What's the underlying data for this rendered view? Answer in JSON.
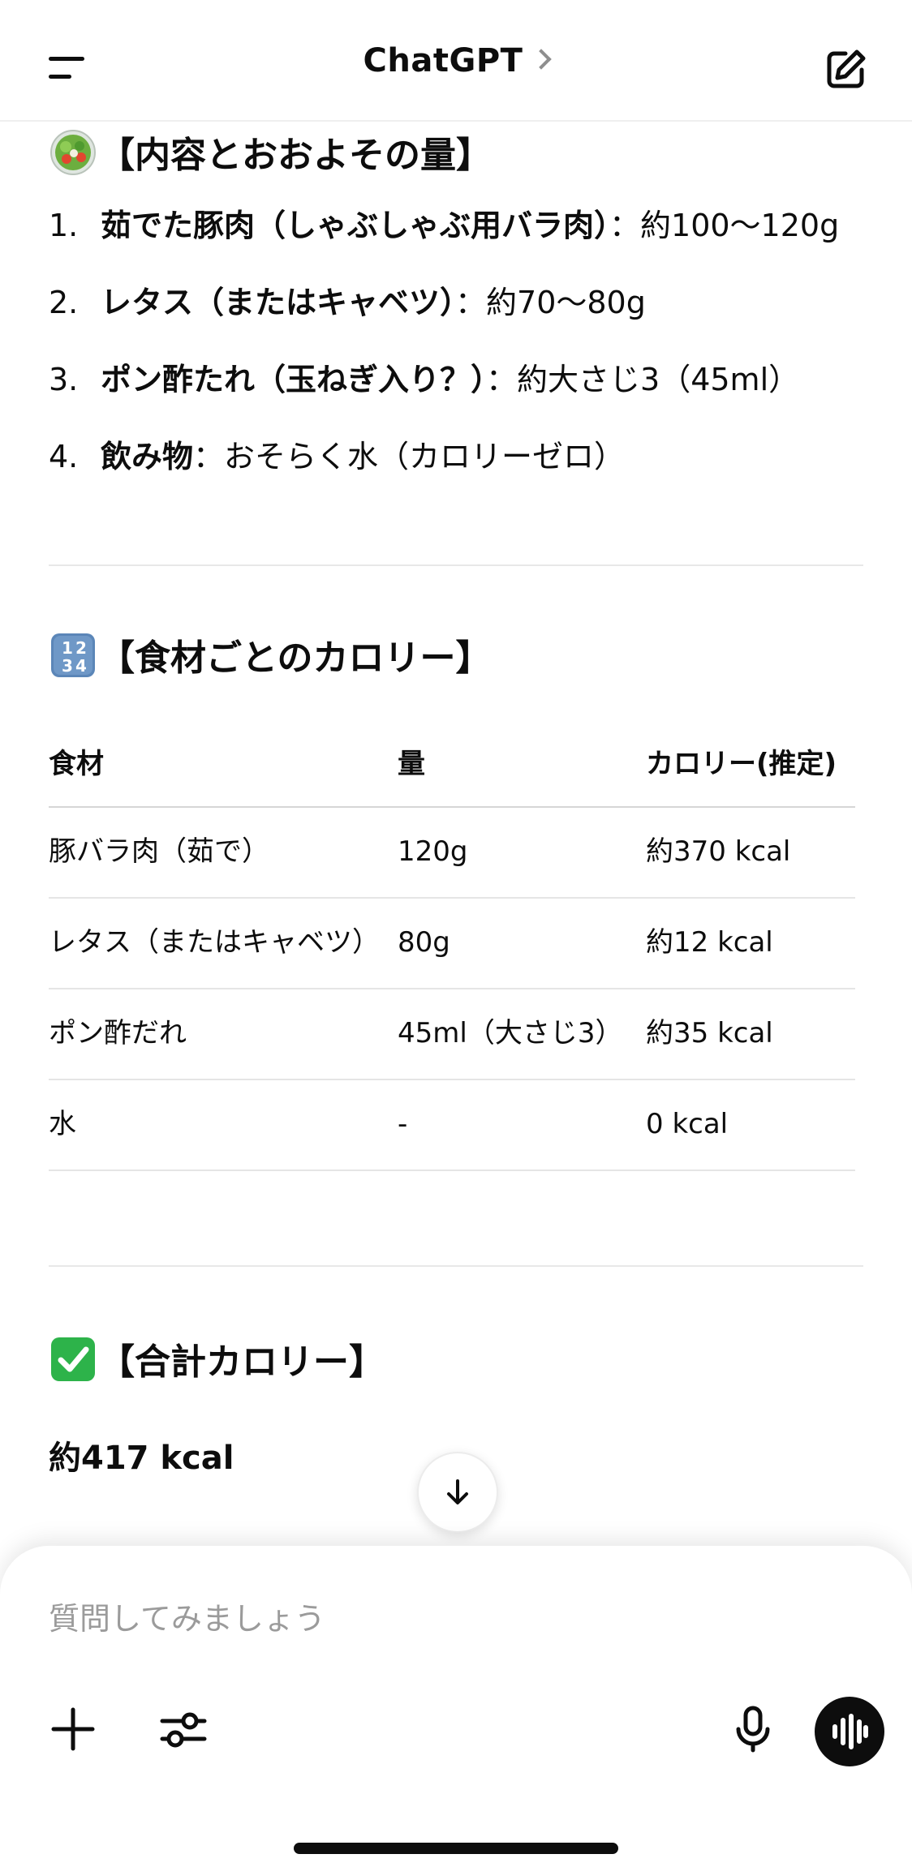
{
  "header": {
    "title": "ChatGPT"
  },
  "contents_section": {
    "heading": "【内容とおおよその量】",
    "items": [
      {
        "number": "1.",
        "name": "茹でた豚肉（しゃぶしゃぶ用バラ肉）",
        "detail": "：約100〜120g"
      },
      {
        "number": "2.",
        "name": "レタス（またはキャベツ）",
        "detail": "：約70〜80g"
      },
      {
        "number": "3.",
        "name": "ポン酢たれ（玉ねぎ入り？）",
        "detail": "：約大さじ3（45ml）"
      },
      {
        "number": "4.",
        "name": "飲み物",
        "detail": "：おそらく水（カロリーゼロ）"
      }
    ]
  },
  "calorie_section": {
    "heading": "【食材ごとのカロリー】",
    "columns": [
      "食材",
      "量",
      "カロリー(推定)"
    ],
    "rows": [
      [
        "豚バラ肉（茹で）",
        "120g",
        "約370 kcal"
      ],
      [
        "レタス（またはキャベツ）",
        "80g",
        "約12 kcal"
      ],
      [
        "ポン酢だれ",
        "45ml（大さじ3）",
        "約35 kcal"
      ],
      [
        "水",
        "-",
        "0 kcal"
      ]
    ]
  },
  "total_section": {
    "heading": "【合計カロリー】",
    "value": "約417 kcal"
  },
  "composer": {
    "placeholder": "質問してみましょう"
  },
  "icons": {
    "menu": "menu-icon",
    "title_chevron": "chevron-right-icon",
    "compose": "edit-icon",
    "salad": "salad-emoji-icon",
    "numbers": "input-numbers-emoji-icon",
    "check": "check-mark-emoji-icon",
    "scroll_down": "arrow-down-icon",
    "plus": "plus-icon",
    "tools": "sliders-icon",
    "mic": "mic-icon",
    "voice": "voice-waveform-icon"
  },
  "colors": {
    "text": "#0d0d0d",
    "placeholder": "#9b9b9b",
    "divider": "#e8e8e8",
    "check_green": "#2db34a",
    "numbers_blue": "#5b86b8"
  }
}
